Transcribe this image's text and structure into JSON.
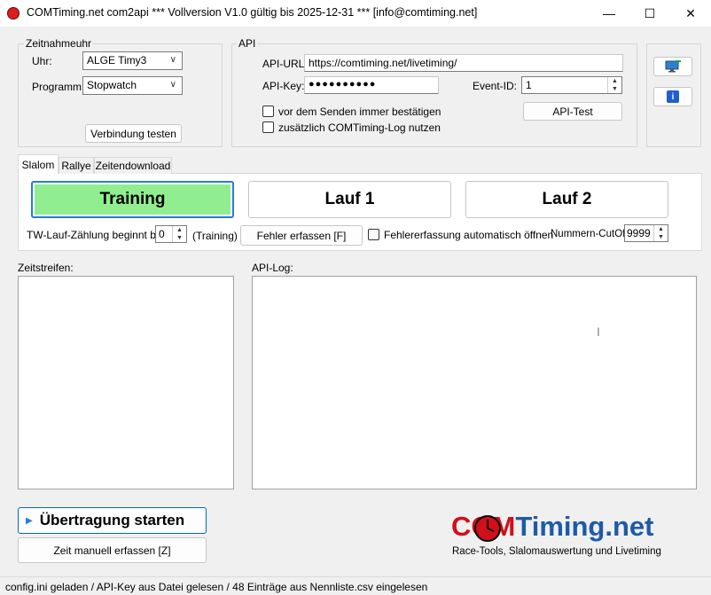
{
  "window": {
    "title": "COMTiming.net com2api *** Vollversion V1.0 gültig bis 2025-12-31 *** [info@comtiming.net]",
    "minimize_glyph": "—",
    "maximize_glyph": "☐",
    "close_glyph": "✕"
  },
  "zeitnahmeuhr": {
    "group_label": "Zeitnahmeuhr",
    "uhr_label": "Uhr:",
    "uhr_value": "ALGE Timy3",
    "programm_label": "Programm:",
    "programm_value": "Stopwatch",
    "test_button": "Verbindung testen"
  },
  "api": {
    "group_label": "API",
    "url_label": "API-URL:",
    "url_value": "https://comtiming.net/livetiming/",
    "key_label": "API-Key:",
    "key_value": "●●●●●●●●●●",
    "event_label": "Event-ID:",
    "event_value": "1",
    "confirm_label": "vor dem Senden immer bestätigen",
    "log_label": "zusätzlich COMTiming-Log nutzen",
    "test_button": "API-Test"
  },
  "side_buttons": {
    "monitor_icon": "monitor-add-icon",
    "info_icon": "info-icon",
    "info_glyph": "i"
  },
  "tabs": [
    {
      "label": "Slalom"
    },
    {
      "label": "Rallye"
    },
    {
      "label": "Zeitendownload"
    }
  ],
  "slalom": {
    "training_button": "Training",
    "lauf1_button": "Lauf 1",
    "lauf2_button": "Lauf 2",
    "tw_label": "TW-Lauf-Zählung beginnt bei:",
    "tw_value": "0",
    "training_note": "(Training)",
    "fehler_button": "Fehler erfassen [F]",
    "auto_label": "Fehlererfassung automatisch öffnen",
    "cutoff_label": "Nummern-CutOff:",
    "cutoff_value": "9999"
  },
  "zeitstreifen_label": "Zeitstreifen:",
  "apilog_label": "API-Log:",
  "bottom": {
    "start_button": "Übertragung starten",
    "manual_button": "Zeit manuell erfassen [Z]"
  },
  "logo": {
    "com": "COM",
    "timing": "Timing.net",
    "tagline": "Race-Tools, Slalomauswertung und Livetiming"
  },
  "status": "config.ini geladen / API-Key aus Datei gelesen / 48 Einträge aus Nennliste.csv eingelesen",
  "colors": {
    "training_active": "#90ee90",
    "logo_red": "#d0101a",
    "logo_blue": "#1f5aa8",
    "accent_blue": "#0067c0"
  }
}
